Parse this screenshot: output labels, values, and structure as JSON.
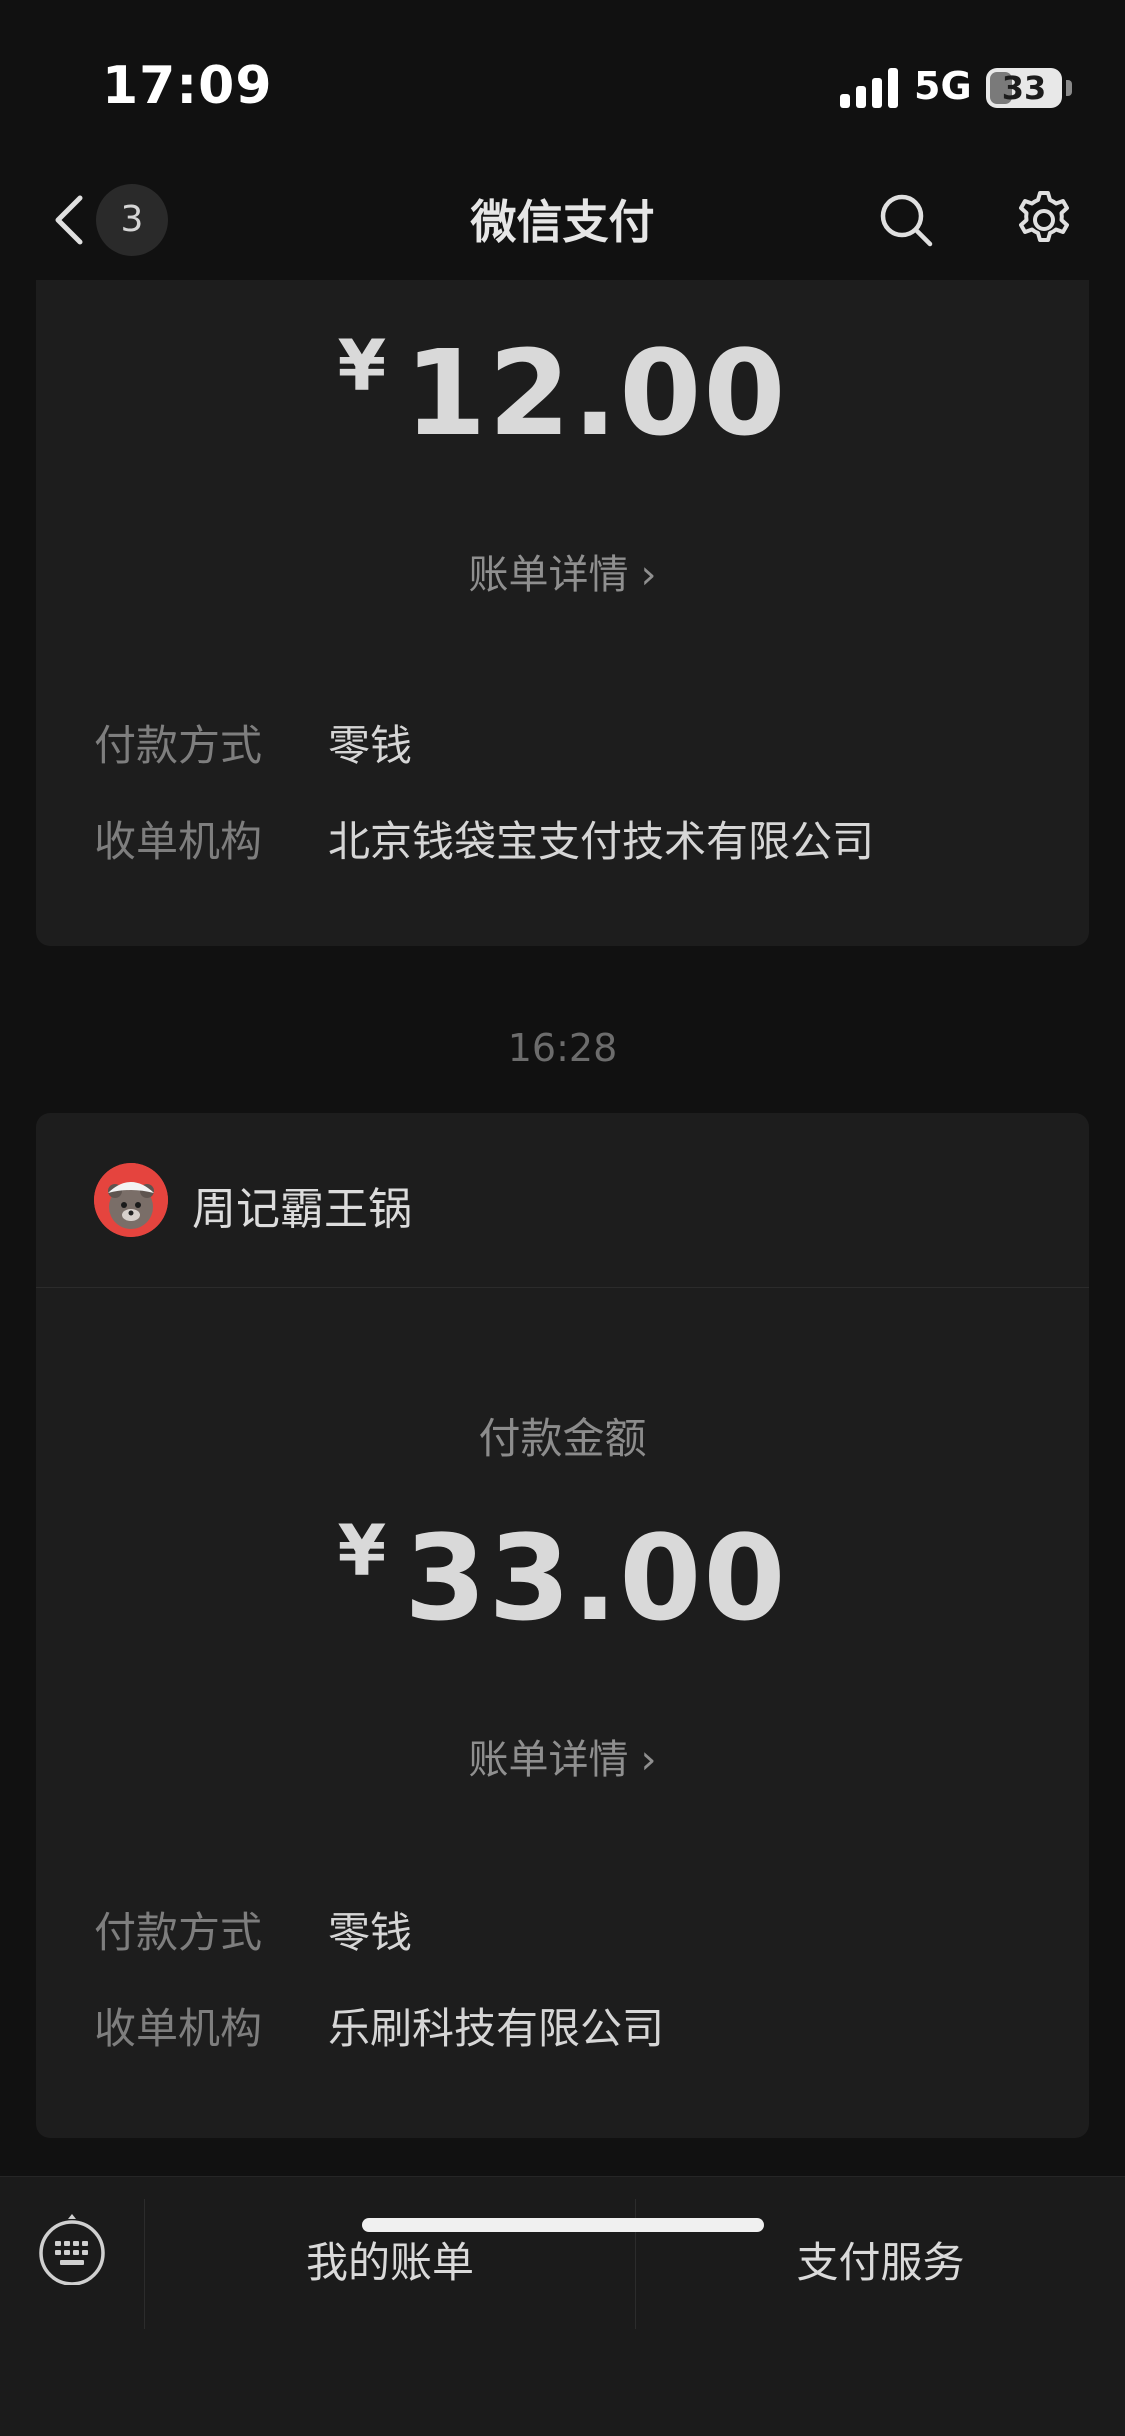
{
  "status": {
    "time": "17:09",
    "network": "5G",
    "battery": "33",
    "battery_level": 0.33
  },
  "nav": {
    "back_count": "3",
    "title": "微信支付",
    "icons": [
      "chevron-left-icon",
      "search-icon",
      "gear-icon"
    ]
  },
  "transactions": [
    {
      "amount_currency": "¥",
      "amount_value": "12.00",
      "detail_link": "账单详情",
      "payment_method_label": "付款方式",
      "payment_method_value": "零钱",
      "acquirer_label": "收单机构",
      "acquirer_value": "北京钱袋宝支付技术有限公司"
    },
    {
      "time": "16:28",
      "merchant": "周记霸王锅",
      "amount_title": "付款金额",
      "amount_currency": "¥",
      "amount_value": "33.00",
      "detail_link": "账单详情",
      "payment_method_label": "付款方式",
      "payment_method_value": "零钱",
      "acquirer_label": "收单机构",
      "acquirer_value": "乐刷科技有限公司"
    }
  ],
  "bottom": {
    "tabs": [
      "我的账单",
      "支付服务"
    ],
    "keyboard_icon": "keyboard-icon"
  }
}
